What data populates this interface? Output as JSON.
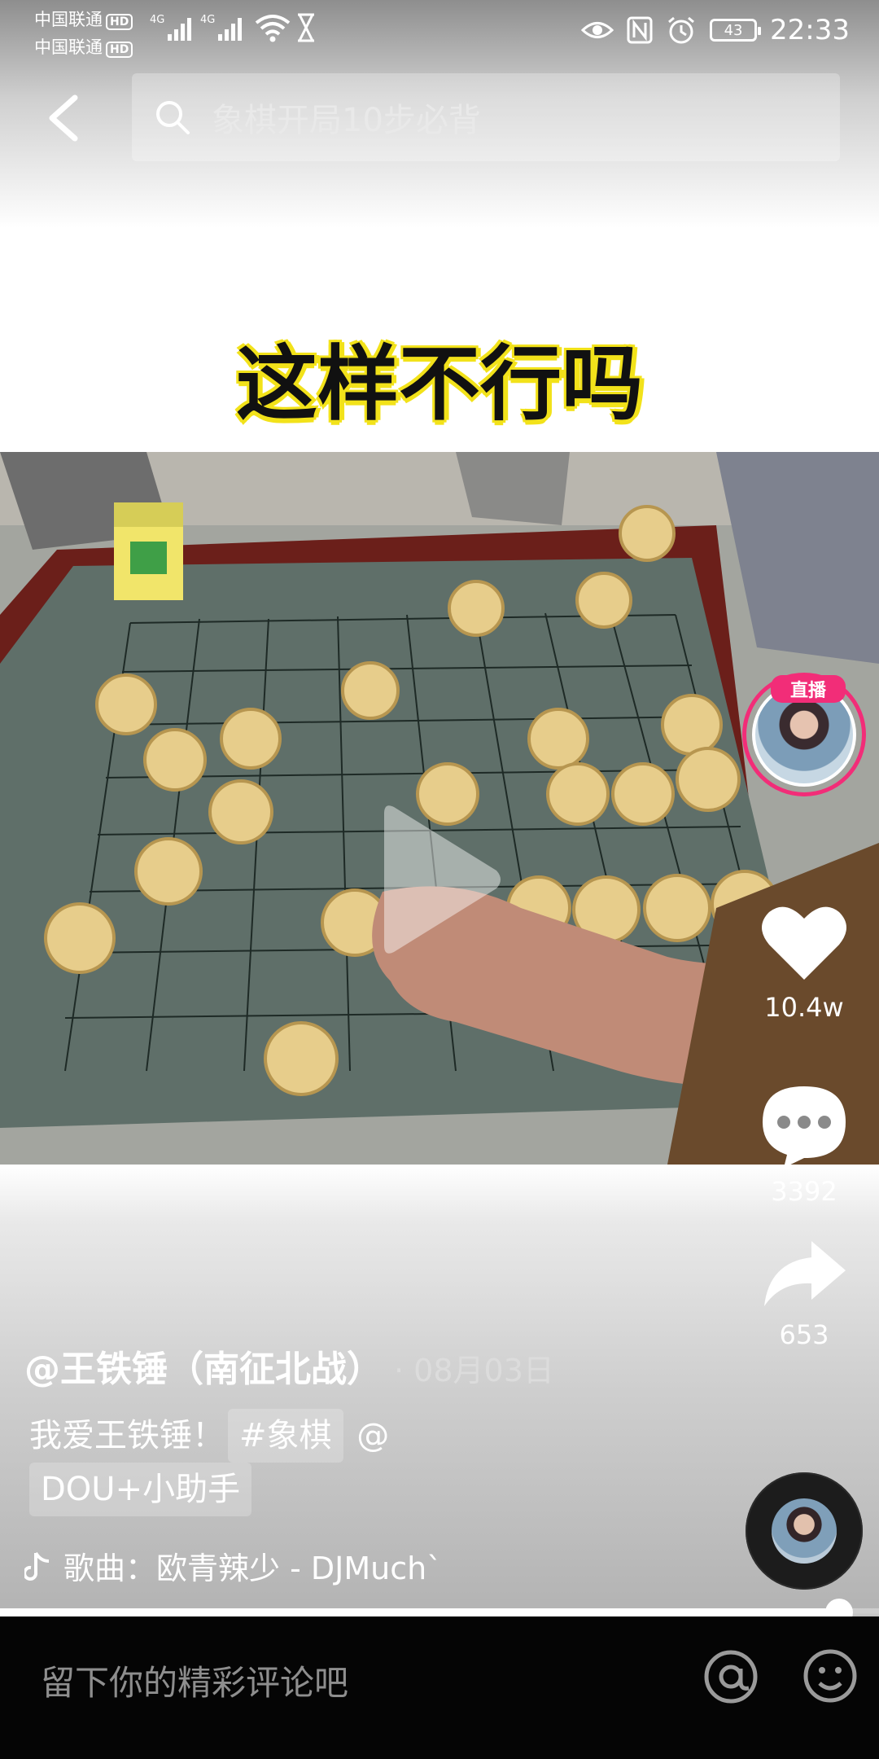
{
  "status_bar": {
    "carrier1": "中国联通",
    "carrier2": "中国联通",
    "hd": "HD",
    "network1": "4G",
    "network2": "4G",
    "battery": "43",
    "time": "22:33"
  },
  "header": {
    "search_placeholder": "象棋开局10步必背"
  },
  "video": {
    "caption": "这样不行吗"
  },
  "actions": {
    "live_label": "直播",
    "likes": "10.4w",
    "comments": "3392",
    "shares": "653"
  },
  "post": {
    "author": "@王铁锤（南征北战）",
    "date": "· 08月03日",
    "text": "我爱王铁锤！",
    "hashtag": "#象棋",
    "mention_at": "@",
    "mention": "DOU+小助手",
    "music": "歌曲：欧青辣少 - DJMuch`"
  },
  "player": {
    "progress": 0.955
  },
  "comment_bar": {
    "placeholder": "留下你的精彩评论吧"
  },
  "colors": {
    "live_pink": "#f22d78",
    "caption_yellow": "#f2e21a",
    "comment_bar_bg": "#050505"
  }
}
